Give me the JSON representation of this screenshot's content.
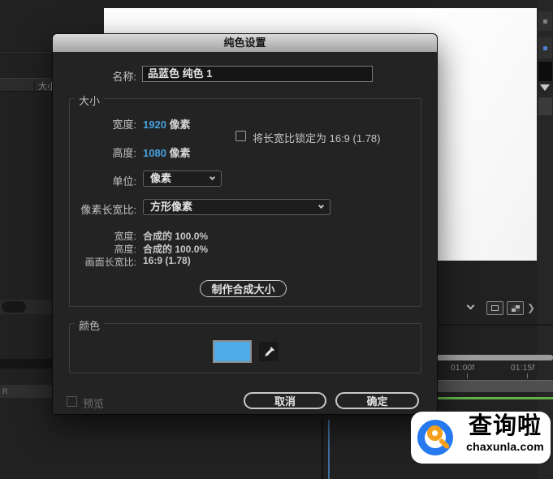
{
  "dialog": {
    "title": "纯色设置",
    "name": {
      "label": "名称:",
      "value": "品蓝色 纯色 1"
    },
    "size": {
      "legend": "大小",
      "width": {
        "label": "宽度:",
        "value": "1920",
        "unit": "像素"
      },
      "height": {
        "label": "高度:",
        "value": "1080",
        "unit": "像素"
      },
      "lock_aspect_label": "将长宽比锁定为 16:9 (1.78)",
      "unit": {
        "label": "单位:",
        "value": "像素"
      },
      "pixel_aspect": {
        "label": "像素长宽比:",
        "value": "方形像素"
      },
      "comp_width": {
        "label": "宽度:",
        "value": "合成的 100.0%"
      },
      "comp_height": {
        "label": "高度:",
        "value": "合成的 100.0%"
      },
      "frame_aspect": {
        "label": "画面长宽比:",
        "value": "16:9 (1.78)"
      },
      "make_comp_size_button": "制作合成大小"
    },
    "color": {
      "legend": "颜色",
      "swatch_hex": "#4FACE8"
    },
    "preview_label": "预览",
    "buttons": {
      "cancel": "取消",
      "ok": "确定"
    }
  },
  "background": {
    "project_panel": {
      "column_header": "大小"
    },
    "timeline": {
      "time_labels": [
        "01:00f",
        "01:15f"
      ]
    }
  },
  "watermark": {
    "brand": "查询啦",
    "domain": "chaxunla.com"
  }
}
